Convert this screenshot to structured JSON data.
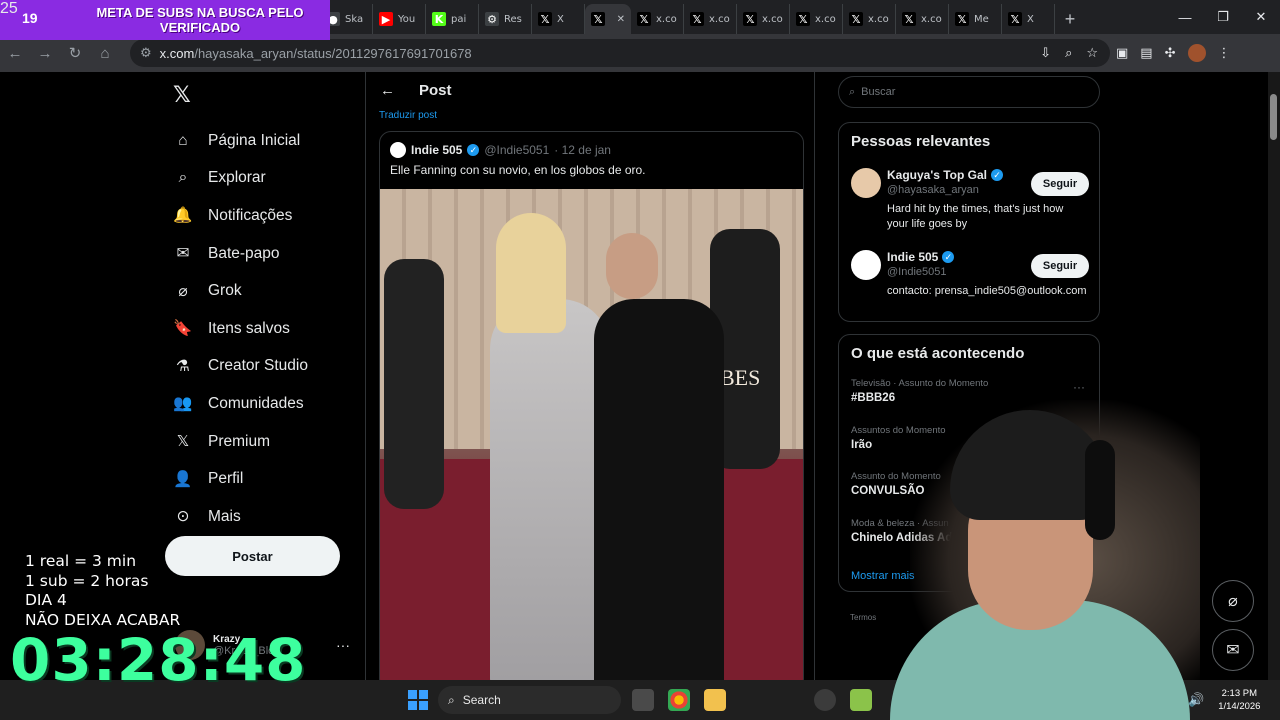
{
  "banner": {
    "count_left": "19",
    "text": "META DE SUBS NA BUSCA PELO VERIFICADO",
    "count_right": "25"
  },
  "browser": {
    "tabs": [
      {
        "label": "Ska",
        "icon": "globe-icon"
      },
      {
        "label": "You",
        "icon": "youtube-icon"
      },
      {
        "label": "pai",
        "icon": "kick-icon"
      },
      {
        "label": "Res",
        "icon": "gear-icon"
      },
      {
        "label": "X",
        "icon": "x-logo-icon"
      },
      {
        "label": "",
        "icon": "x-logo-icon"
      },
      {
        "label": "x.co",
        "icon": "x-logo-icon"
      },
      {
        "label": "x.co",
        "icon": "x-logo-icon"
      },
      {
        "label": "x.co",
        "icon": "x-logo-icon"
      },
      {
        "label": "x.co",
        "icon": "x-logo-icon"
      },
      {
        "label": "x.co",
        "icon": "x-logo-icon"
      },
      {
        "label": "x.co",
        "icon": "x-logo-icon"
      },
      {
        "label": "Me",
        "icon": "x-logo-icon"
      },
      {
        "label": "X",
        "icon": "x-logo-icon"
      }
    ],
    "url_domain": "x.com",
    "url_path": "/hayasaka_aryan/status/2011297617691701678"
  },
  "nav": {
    "items": [
      {
        "label": "Página Inicial",
        "icon": "home-icon"
      },
      {
        "label": "Explorar",
        "icon": "search-icon"
      },
      {
        "label": "Notificações",
        "icon": "bell-icon"
      },
      {
        "label": "Bate-papo",
        "icon": "mail-icon"
      },
      {
        "label": "Grok",
        "icon": "grok-icon"
      },
      {
        "label": "Itens salvos",
        "icon": "bookmark-icon"
      },
      {
        "label": "Creator Studio",
        "icon": "flask-icon"
      },
      {
        "label": "Comunidades",
        "icon": "people-icon"
      },
      {
        "label": "Premium",
        "icon": "x-logo-icon"
      },
      {
        "label": "Perfil",
        "icon": "person-icon"
      },
      {
        "label": "Mais",
        "icon": "more-circle-icon"
      }
    ],
    "post_button": "Postar",
    "account_name": "Krazy",
    "account_handle": "@Krazy_Blog"
  },
  "post": {
    "header": "Post",
    "translate": "Traduzir post",
    "quote_name": "Indie 505",
    "quote_handle": "@Indie5051",
    "quote_date": "· 12 de jan",
    "quote_text": "Elle Fanning con su novio, en los globos de oro.",
    "photo_sign": "BES"
  },
  "sidebar": {
    "search_placeholder": "Buscar",
    "relevant_title": "Pessoas relevantes",
    "people": [
      {
        "name": "Kaguya's Top Gal",
        "handle": "@hayasaka_aryan",
        "bio": "Hard hit by the times, that's just how your life goes by",
        "button": "Seguir",
        "avatar_color": "#e7c9a9"
      },
      {
        "name": "Indie 505",
        "handle": "@Indie5051",
        "bio": "contacto: prensa_indie505@outlook.com",
        "button": "Seguir",
        "avatar_color": "#ffffff"
      }
    ],
    "trending_title": "O que está acontecendo",
    "trends": [
      {
        "category": "Televisão · Assunto do Momento",
        "title": "#BBB26"
      },
      {
        "category": "Assuntos do Momento",
        "title": "Irão"
      },
      {
        "category": "Assunto do Momento",
        "title": "CONVULSÃO"
      },
      {
        "category": "Moda & beleza · Assun",
        "title": "Chinelo Adidas Adilet"
      }
    ],
    "show_more": "Mostrar mais",
    "terms": "Termos"
  },
  "overlay": {
    "rules": [
      "1 real = 3 min",
      "1 sub = 2 horas",
      "DIA 4",
      "NÃO DEIXA ACABAR"
    ],
    "timer": "03:28:48"
  },
  "taskbar": {
    "search": "Search",
    "time": "2:13 PM",
    "date": "1/14/2026"
  },
  "colors": {
    "accent": "#1d9bf0",
    "timer": "#3dff9e",
    "banner": "#8a2be2"
  }
}
